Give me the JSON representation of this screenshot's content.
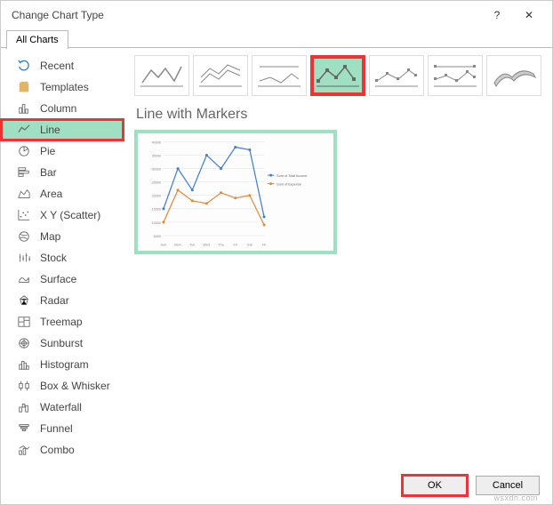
{
  "window": {
    "title": "Change Chart Type",
    "help": "?",
    "close": "✕"
  },
  "tabs": {
    "all": "All Charts"
  },
  "sidebar": {
    "items": [
      {
        "label": "Recent"
      },
      {
        "label": "Templates"
      },
      {
        "label": "Column"
      },
      {
        "label": "Line"
      },
      {
        "label": "Pie"
      },
      {
        "label": "Bar"
      },
      {
        "label": "Area"
      },
      {
        "label": "X Y (Scatter)"
      },
      {
        "label": "Map"
      },
      {
        "label": "Stock"
      },
      {
        "label": "Surface"
      },
      {
        "label": "Radar"
      },
      {
        "label": "Treemap"
      },
      {
        "label": "Sunburst"
      },
      {
        "label": "Histogram"
      },
      {
        "label": "Box & Whisker"
      },
      {
        "label": "Waterfall"
      },
      {
        "label": "Funnel"
      },
      {
        "label": "Combo"
      }
    ]
  },
  "main": {
    "subtitle": "Line with Markers",
    "preview_legend": {
      "series1": "Sum of Total Income",
      "series2": "Sum of Expense"
    }
  },
  "footer": {
    "ok": "OK",
    "cancel": "Cancel"
  },
  "watermark": "wsxdn.com",
  "chart_data": {
    "type": "line",
    "categories": [
      "Sun",
      "Mon",
      "Tue",
      "Wed",
      "Thu",
      "Fri",
      "Sat",
      "Fri"
    ],
    "series": [
      {
        "name": "Sum of Total Income",
        "values": [
          15000,
          30000,
          22000,
          35000,
          30000,
          38000,
          37000,
          12000
        ]
      },
      {
        "name": "Sum of Expense",
        "values": [
          10000,
          22000,
          18000,
          17000,
          21000,
          19000,
          20000,
          9000
        ]
      }
    ],
    "ylim": [
      5000,
      40000
    ],
    "ystep": 5000,
    "legend_position": "right",
    "marker": true
  }
}
